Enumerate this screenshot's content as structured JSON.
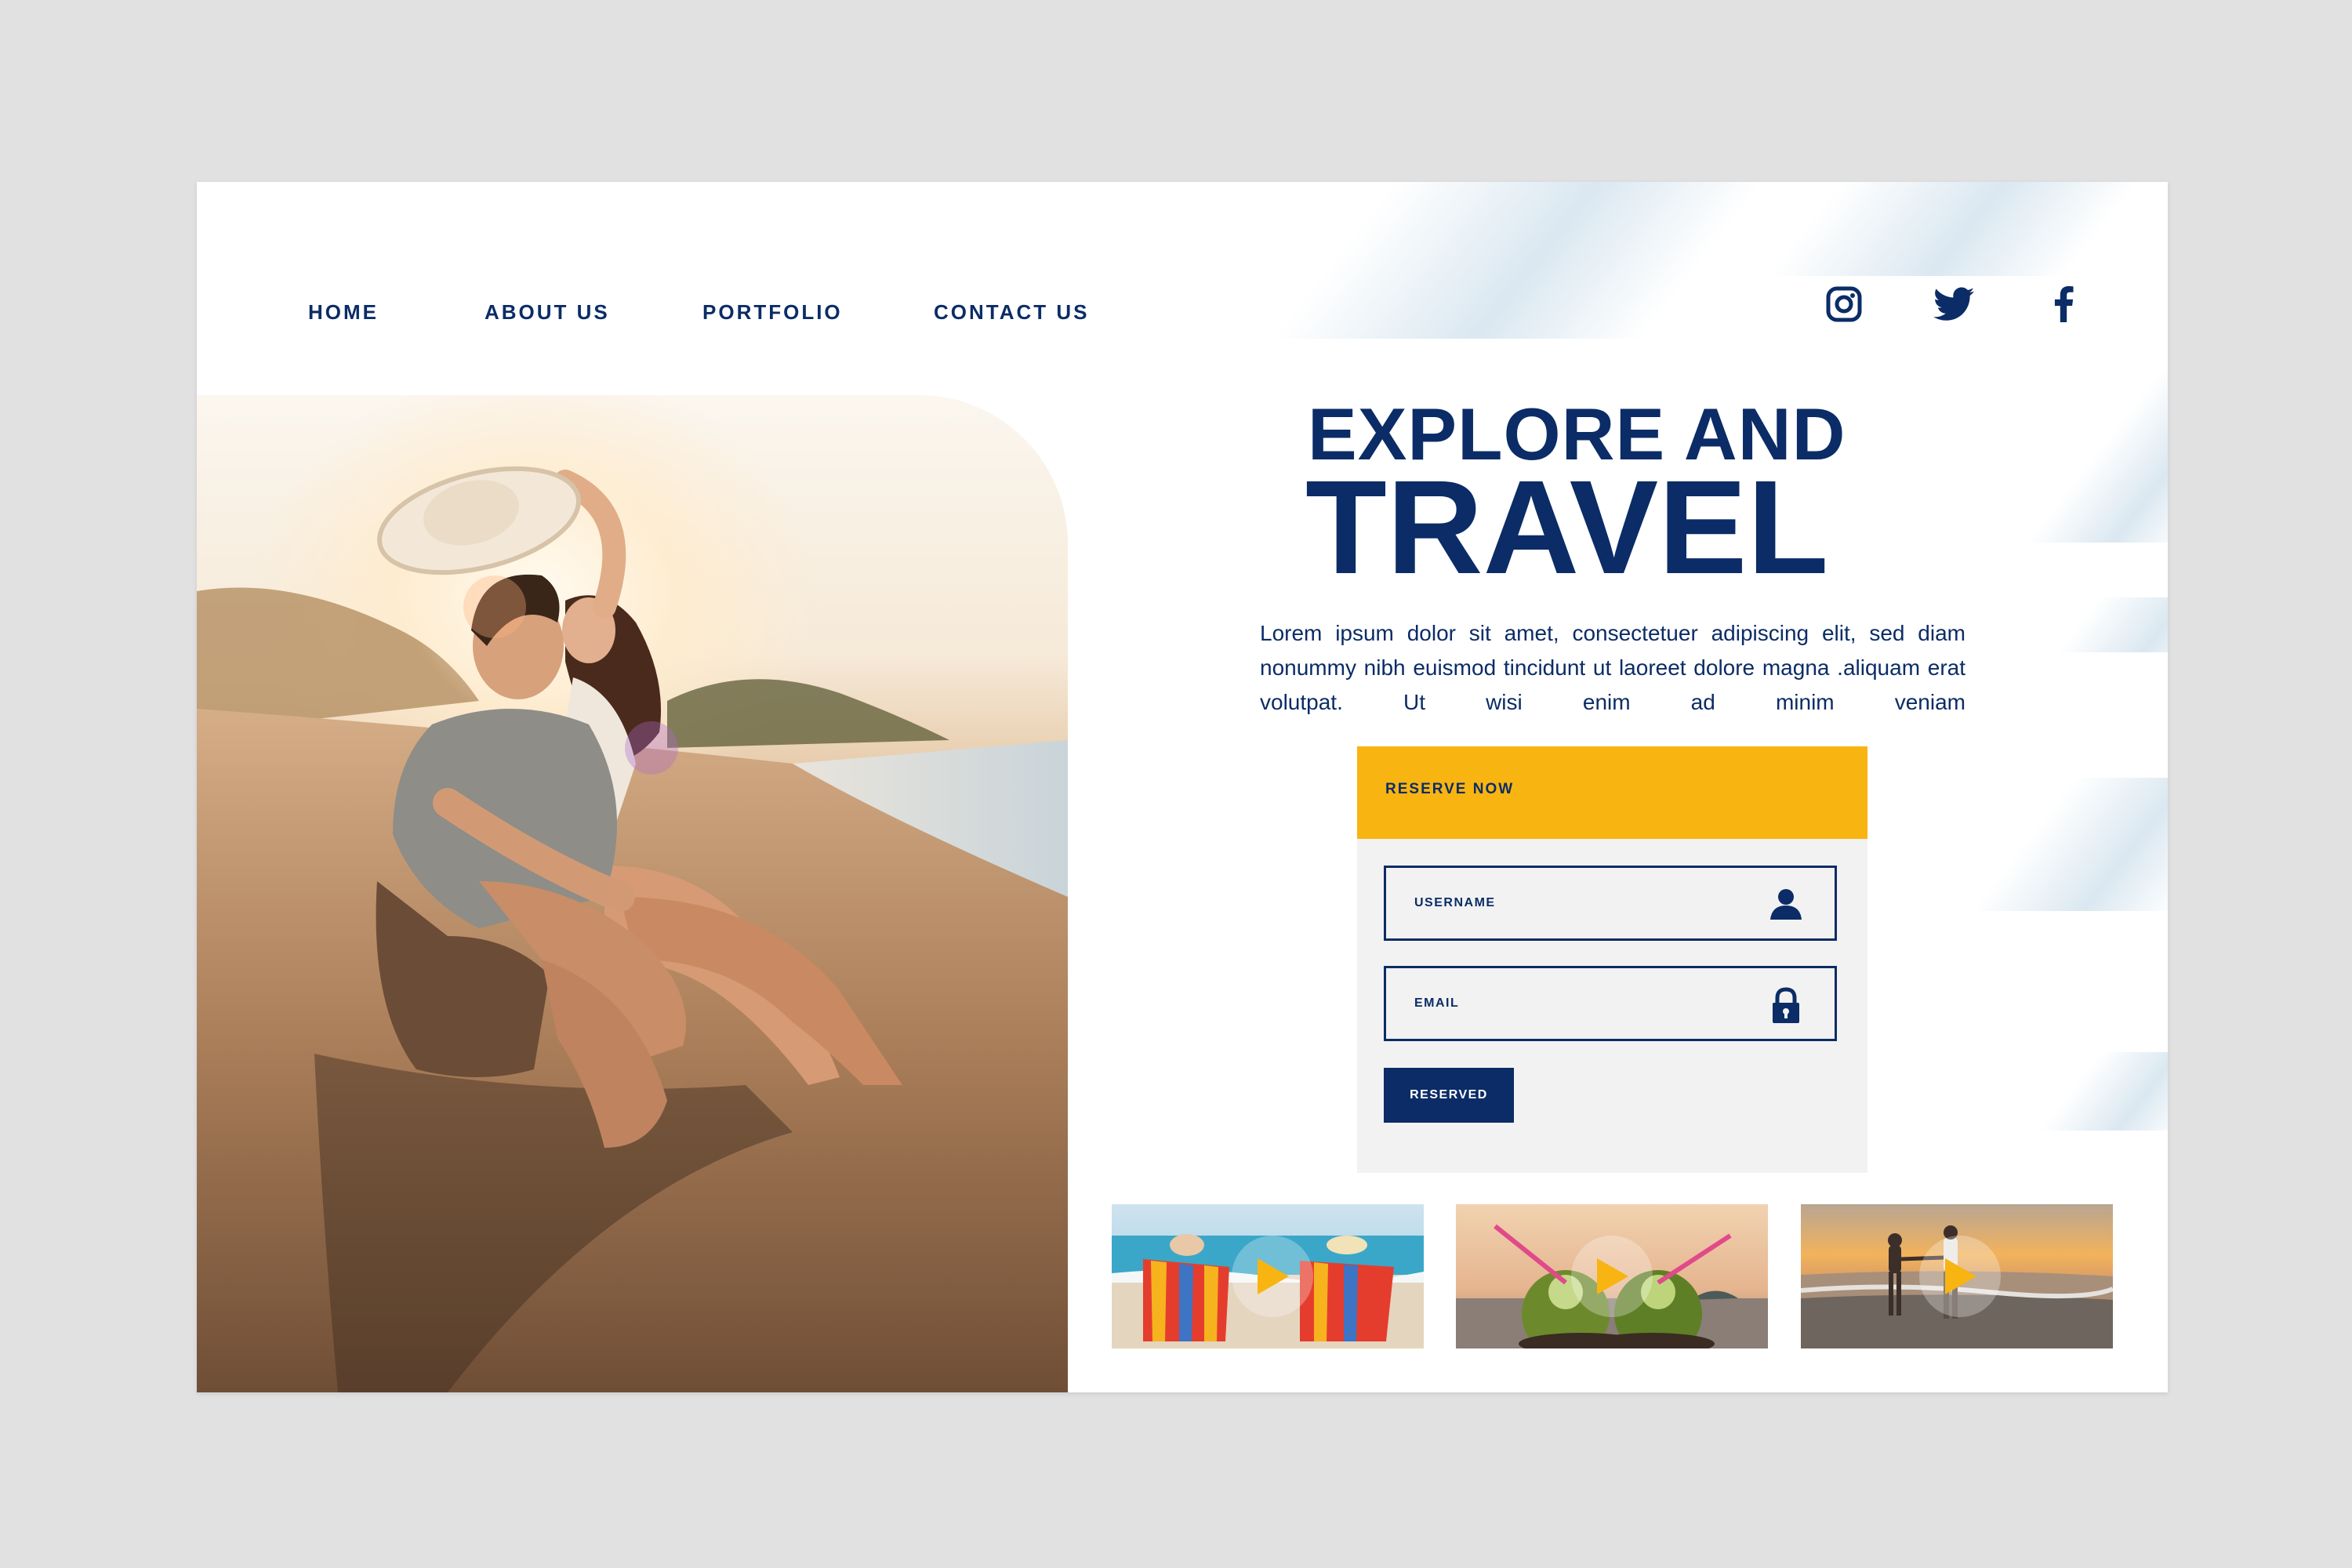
{
  "nav": {
    "items": [
      {
        "label": "HOME"
      },
      {
        "label": "ABOUT US"
      },
      {
        "label": "PORTFOLIO"
      },
      {
        "label": "CONTACT US"
      }
    ]
  },
  "social": {
    "icons": [
      "instagram-icon",
      "twitter-icon",
      "facebook-icon"
    ]
  },
  "hero": {
    "title_line1": "EXPLORE AND",
    "title_line2": "TRAVEL",
    "body": "Lorem ipsum dolor sit amet, consectetuer adipiscing elit, sed diam nonummy nibh euismod tincidunt ut laoreet dolore magna .aliquam erat volutpat. Ut wisi enim ad minim veniam"
  },
  "form": {
    "header": "RESERVE NOW",
    "username_placeholder": "USERNAME",
    "email_placeholder": "EMAIL",
    "submit_label": "RESERVED"
  },
  "thumbnails": [
    {
      "scene": "beach-chairs",
      "icon": "play-icon"
    },
    {
      "scene": "coconut-drinks",
      "icon": "play-icon"
    },
    {
      "scene": "couple-walking",
      "icon": "play-icon"
    }
  ],
  "colors": {
    "navy": "#0b2c66",
    "accent": "#f8b411",
    "panel": "#f2f2f2",
    "background": "#e1e1e1"
  }
}
